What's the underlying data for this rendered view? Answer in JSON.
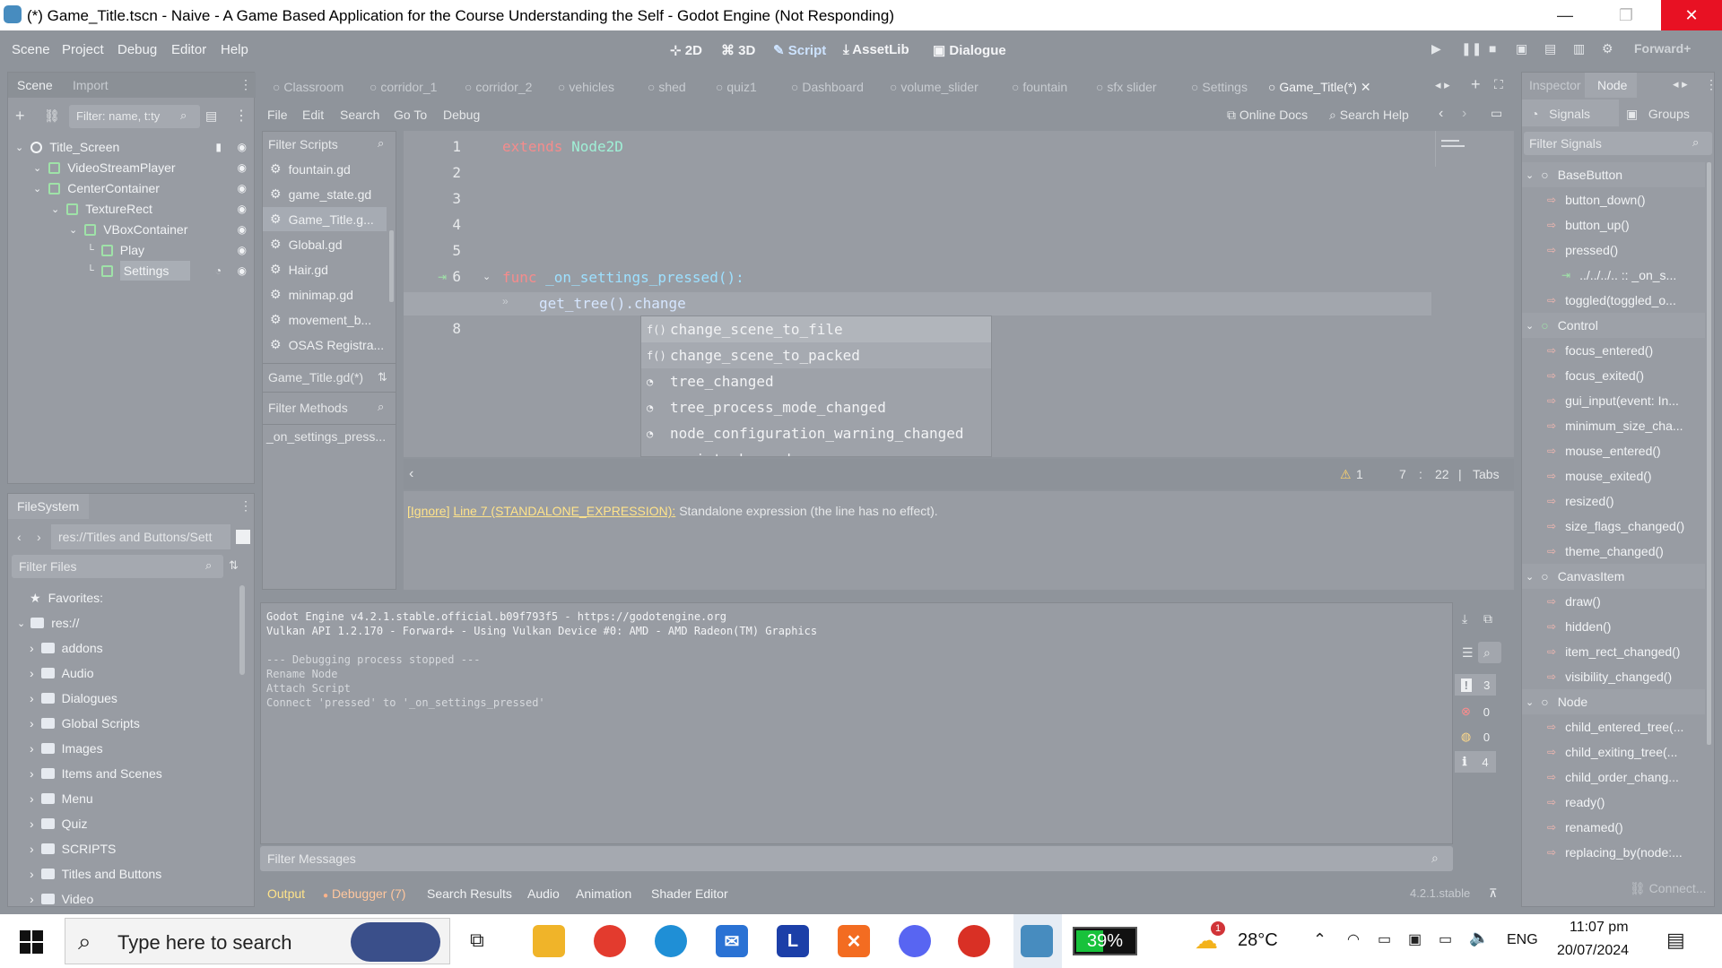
{
  "window": {
    "title": "(*) Game_Title.tscn - Naive - A Game Based Application for the Course Understanding the Self - Godot Engine (Not Responding)",
    "minimize": "—",
    "maximize": "❐",
    "close": "✕"
  },
  "menu": [
    "Scene",
    "Project",
    "Debug",
    "Editor",
    "Help"
  ],
  "workspaces": [
    {
      "label": "2D",
      "icon": "⊹"
    },
    {
      "label": "3D",
      "icon": "⌘"
    },
    {
      "label": "Script",
      "icon": "✎"
    },
    {
      "label": "AssetLib",
      "icon": "⤓"
    },
    {
      "label": "Dialogue",
      "icon": "▣"
    }
  ],
  "renderer": "Forward+",
  "scene_dock": {
    "tabs": [
      "Scene",
      "Import"
    ],
    "filter_placeholder": "Filter: name, t:ty",
    "nodes": [
      {
        "name": "Title_Screen",
        "depth": 0
      },
      {
        "name": "VideoStreamPlayer",
        "depth": 1
      },
      {
        "name": "CenterContainer",
        "depth": 1
      },
      {
        "name": "TextureRect",
        "depth": 2
      },
      {
        "name": "VBoxContainer",
        "depth": 3
      },
      {
        "name": "Play",
        "depth": 4
      },
      {
        "name": "Settings",
        "depth": 4
      }
    ]
  },
  "filesystem": {
    "title": "FileSystem",
    "path": "res://Titles and Buttons/Sett",
    "filter_placeholder": "Filter Files",
    "favorites": "Favorites:",
    "root": "res://",
    "folders": [
      "addons",
      "Audio",
      "Dialogues",
      "Global Scripts",
      "Images",
      "Items and Scenes",
      "Menu",
      "Quiz",
      "SCRIPTS",
      "Titles and Buttons",
      "Video"
    ]
  },
  "scene_tabs": [
    "Classroom",
    "corridor_1",
    "corridor_2",
    "vehicles",
    "shed",
    "quiz1",
    "Dashboard",
    "volume_slider",
    "fountain",
    "sfx slider",
    "Settings",
    "Game_Title(*)"
  ],
  "script_menu": [
    "File",
    "Edit",
    "Search",
    "Go To",
    "Debug"
  ],
  "script_links": {
    "docs": "Online Docs",
    "help": "Search Help"
  },
  "scripts_panel": {
    "filter_placeholder": "Filter Scripts",
    "items": [
      "fountain.gd",
      "game_state.gd",
      "Game_Title.g...",
      "Global.gd",
      "Hair.gd",
      "minimap.gd",
      "movement_b...",
      "OSAS Registra..."
    ],
    "current": "Game_Title.gd(*)",
    "methods_placeholder": "Filter Methods",
    "methods": [
      "_on_settings_press..."
    ]
  },
  "code": {
    "lines": [
      "1",
      "2",
      "3",
      "4",
      "5",
      "6",
      "7",
      "8"
    ],
    "line1_kw": "extends",
    "line1_rest": " Node2D",
    "line6_kw": "func",
    "line6_rest": " _on_settings_pressed():",
    "line7": "get_tree().change",
    "autocomplete": [
      {
        "icon": "f()",
        "text": "change_scene_to_file"
      },
      {
        "icon": "f()",
        "text": "change_scene_to_packed"
      },
      {
        "icon": "◔",
        "text": "tree_changed"
      },
      {
        "icon": "◔",
        "text": "tree_process_mode_changed"
      },
      {
        "icon": "◔",
        "text": "node_configuration_warning_changed"
      },
      {
        "icon": "◔",
        "text": "script_changed"
      }
    ],
    "status": {
      "warnings": "1",
      "line": "7",
      "col": "22",
      "indent": "Tabs"
    },
    "warning_ignore": "[Ignore]",
    "warning_link": "Line 7 (STANDALONE_EXPRESSION):",
    "warning_text": " Standalone expression (the line has no effect)."
  },
  "output": {
    "lines": [
      "Godot Engine v4.2.1.stable.official.b09f793f5 - https://godotengine.org",
      "Vulkan API 1.2.170 - Forward+ - Using Vulkan Device #0: AMD - AMD Radeon(TM) Graphics",
      "",
      "--- Debugging process stopped ---",
      "Rename Node",
      "Attach Script",
      "Connect 'pressed' to '_on_settings_pressed'"
    ],
    "filter_placeholder": "Filter Messages",
    "counts": [
      "3",
      "0",
      "0",
      "4"
    ]
  },
  "bottom_tabs": [
    "Output",
    "Debugger (7)",
    "Search Results",
    "Audio",
    "Animation",
    "Shader Editor"
  ],
  "version": "4.2.1.stable",
  "inspector": {
    "tabs": [
      "Inspector",
      "Node"
    ],
    "subtabs": [
      "Signals",
      "Groups"
    ],
    "filter_placeholder": "Filter Signals",
    "groups": [
      {
        "name": "BaseButton",
        "signals": [
          "button_down()",
          "button_up()",
          "pressed()",
          "../../../.. :: _on_s...",
          "toggled(toggled_o..."
        ]
      },
      {
        "name": "Control",
        "signals": [
          "focus_entered()",
          "focus_exited()",
          "gui_input(event: In...",
          "minimum_size_cha...",
          "mouse_entered()",
          "mouse_exited()",
          "resized()",
          "size_flags_changed()",
          "theme_changed()"
        ]
      },
      {
        "name": "CanvasItem",
        "signals": [
          "draw()",
          "hidden()",
          "item_rect_changed()",
          "visibility_changed()"
        ]
      },
      {
        "name": "Node",
        "signals": [
          "child_entered_tree(...",
          "child_exiting_tree(...",
          "child_order_chang...",
          "ready()",
          "renamed()",
          "replacing_by(node:..."
        ]
      }
    ],
    "connect": "Connect..."
  },
  "taskbar": {
    "search_placeholder": "Type here to search",
    "battery": "39%",
    "weather": "28°C",
    "weather_badge": "1",
    "lang": "ENG",
    "time": "11:07 pm",
    "date": "20/07/2024"
  },
  "colors": {
    "keyword": "#f58c8c",
    "func_name": "#9de0ff",
    "class_name": "#9ff0d6",
    "link": "#ffe38a"
  }
}
